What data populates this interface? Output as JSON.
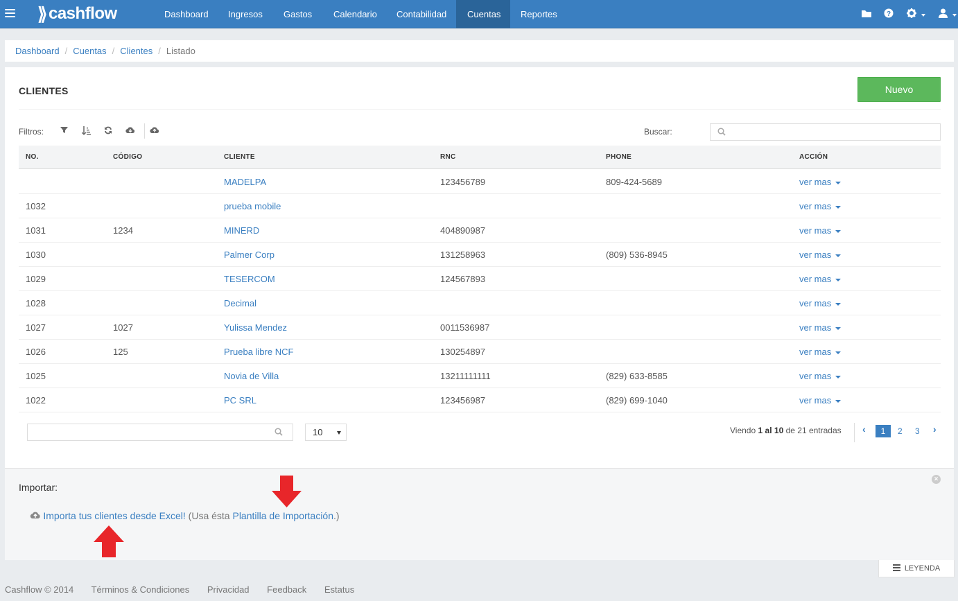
{
  "brand": {
    "name": "cashflow",
    "mark": "⟫"
  },
  "nav": {
    "items": [
      {
        "label": "Dashboard"
      },
      {
        "label": "Ingresos"
      },
      {
        "label": "Gastos"
      },
      {
        "label": "Calendario"
      },
      {
        "label": "Contabilidad"
      },
      {
        "label": "Cuentas"
      },
      {
        "label": "Reportes"
      }
    ],
    "active": "Cuentas",
    "right_icons": [
      "folder-icon",
      "help-icon",
      "gear-icon",
      "user-icon"
    ]
  },
  "breadcrumb": {
    "items": [
      "Dashboard",
      "Cuentas",
      "Clientes"
    ],
    "current": "Listado"
  },
  "page": {
    "title": "CLIENTES",
    "new_button": "Nuevo",
    "filters_label": "Filtros:",
    "filter_icons": [
      "filter-icon",
      "sort-icon",
      "refresh-icon",
      "cloud-download-icon",
      "cloud-upload-icon"
    ],
    "search_label": "Buscar:"
  },
  "table": {
    "columns": [
      "NO.",
      "CÓDIGO",
      "CLIENTE",
      "RNC",
      "PHONE",
      "ACCIÓN"
    ],
    "action_label": "ver mas",
    "rows": [
      {
        "no": "",
        "codigo": "",
        "cliente": "MADELPA",
        "rnc": "123456789",
        "phone": "809-424-5689"
      },
      {
        "no": "1032",
        "codigo": "",
        "cliente": "prueba mobile",
        "rnc": "",
        "phone": ""
      },
      {
        "no": "1031",
        "codigo": "1234",
        "cliente": "MINERD",
        "rnc": "404890987",
        "phone": ""
      },
      {
        "no": "1030",
        "codigo": "",
        "cliente": "Palmer Corp",
        "rnc": "131258963",
        "phone": "(809) 536-8945"
      },
      {
        "no": "1029",
        "codigo": "",
        "cliente": "TESERCOM",
        "rnc": "124567893",
        "phone": ""
      },
      {
        "no": "1028",
        "codigo": "",
        "cliente": "Decimal",
        "rnc": "",
        "phone": ""
      },
      {
        "no": "1027",
        "codigo": "1027",
        "cliente": "Yulissa Mendez",
        "rnc": "0011536987",
        "phone": ""
      },
      {
        "no": "1026",
        "codigo": "125",
        "cliente": "Prueba libre NCF",
        "rnc": "130254897",
        "phone": ""
      },
      {
        "no": "1025",
        "codigo": "",
        "cliente": "Novia de Villa",
        "rnc": "13211111111",
        "phone": "(829) 633-8585"
      },
      {
        "no": "1022",
        "codigo": "",
        "cliente": "PC SRL",
        "rnc": "123456987",
        "phone": "(829) 699-1040"
      }
    ]
  },
  "pagination": {
    "per_page": "10",
    "info_prefix": "Viendo",
    "from": "1",
    "mid": "al",
    "to": "10",
    "info_suffix": "de 21 entradas",
    "pages": [
      "1",
      "2",
      "3"
    ],
    "current_page": "1",
    "prev": "‹",
    "next": "›"
  },
  "import": {
    "title": "Importar:",
    "close": "×",
    "link_text": "Importa tus clientes desde Excel!",
    "middle_text": " (Usa ésta ",
    "template_link": "Plantilla de Importación",
    "end_text": ".)"
  },
  "legend_button": "LEYENDA",
  "footer": {
    "items": [
      "Cashflow © 2014",
      "Términos & Condiciones",
      "Privacidad",
      "Feedback",
      "Estatus"
    ]
  },
  "colors": {
    "primary": "#3a7fc1",
    "success": "#5cb85c",
    "annotation_arrow": "#e8262a"
  }
}
